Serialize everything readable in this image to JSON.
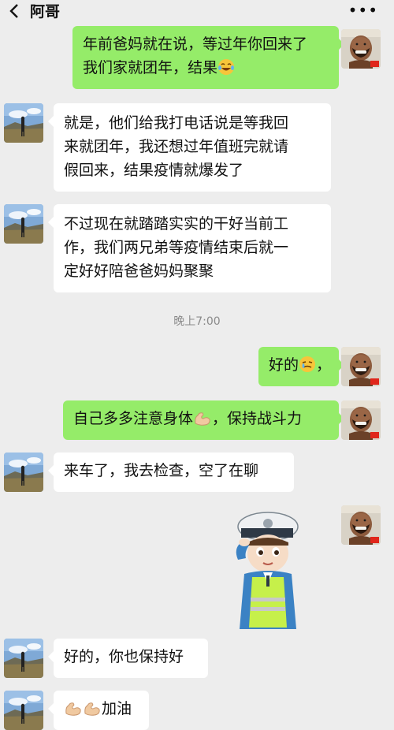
{
  "header": {
    "title": "阿哥",
    "more": "•••"
  },
  "colors": {
    "background": "#ededed",
    "incoming_bubble": "#ffffff",
    "outgoing_bubble": "#95ec69"
  },
  "messages": [
    {
      "from": "me",
      "lines": [
        "年前爸妈就在说，等过年你回来了",
        "我们家就团年，结果"
      ],
      "trailing_emoji": "tears-of-joy-emoji"
    },
    {
      "from": "brother",
      "lines": [
        "就是，他们给我打电话说是等我回",
        "来就团年，我还想过年值班完就请",
        "假回来，结果疫情就爆发了"
      ]
    },
    {
      "from": "brother",
      "lines": [
        "不过现在就踏踏实实的干好当前工",
        "作，我们两兄弟等疫情结束后就一",
        "定好好陪爸爸妈妈聚聚"
      ]
    },
    {
      "from": "me",
      "text_before": "好的",
      "emoji": "crying-emoji",
      "text_after": "，"
    },
    {
      "from": "me",
      "text_before": "自己多多注意身体",
      "emoji": "flexed-biceps-emoji",
      "text_after": "，保持战斗力"
    },
    {
      "from": "brother",
      "text": "来车了，我去检查，空了在聊"
    },
    {
      "from": "me",
      "sticker": "police-officer-salute-sticker"
    },
    {
      "from": "brother",
      "text": "好的，你也保持好"
    },
    {
      "from": "brother",
      "emojis": [
        "flexed-biceps-emoji",
        "flexed-biceps-emoji"
      ],
      "text": "加油"
    }
  ],
  "timestamp": "晚上7:00"
}
